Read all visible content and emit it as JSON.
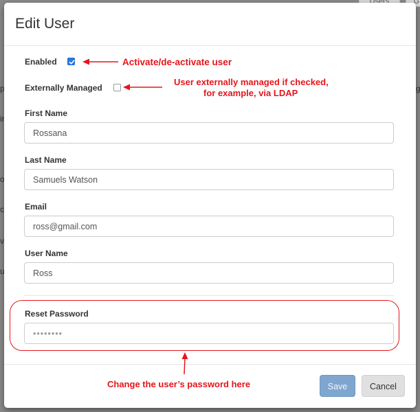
{
  "background": {
    "tabs": [
      "Users",
      "G"
    ],
    "left_edge_glyphs": [
      "p",
      "ir",
      "o",
      "cc",
      "vi",
      "u"
    ],
    "right_edge_glyphs": [
      "g"
    ]
  },
  "modal": {
    "title": "Edit User",
    "enabled": {
      "label": "Enabled",
      "checked": true
    },
    "externally_managed": {
      "label": "Externally Managed",
      "checked": false
    },
    "first_name": {
      "label": "First Name",
      "value": "Rossana"
    },
    "last_name": {
      "label": "Last Name",
      "value": "Samuels Watson"
    },
    "email": {
      "label": "Email",
      "value": "ross@gmail.com"
    },
    "user_name": {
      "label": "User Name",
      "value": "Ross"
    },
    "reset_password": {
      "label": "Reset Password",
      "value": "••••••••"
    },
    "save_label": "Save",
    "cancel_label": "Cancel"
  },
  "annotations": {
    "enabled_note": "Activate/de-activate user",
    "external_note_line1": "User externally managed if checked,",
    "external_note_line2": "for example, via LDAP",
    "password_note": "Change the user’s password here"
  },
  "colors": {
    "annotation_red": "#e4151b",
    "checkbox_blue": "#2a7be4",
    "save_button": "#7fa6cf",
    "cancel_button": "#e0e0e0",
    "overlay_gray": "#8a8a8a"
  }
}
